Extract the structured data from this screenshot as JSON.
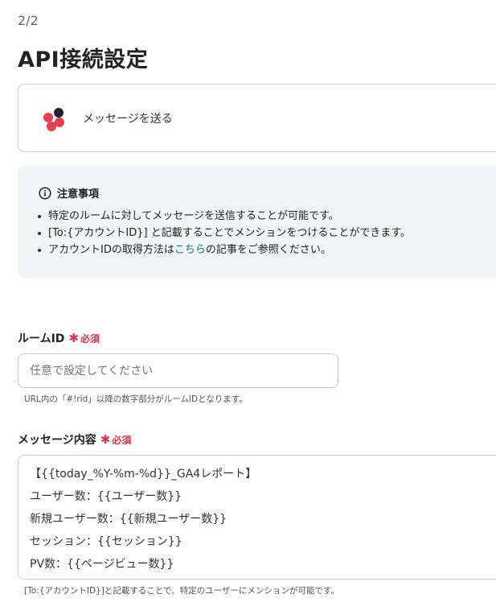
{
  "header": {
    "step": "2/2",
    "title": "API接続設定"
  },
  "action": {
    "label": "メッセージを送る",
    "app_icon": "chatwork-logo",
    "colors": {
      "dark": "#1f2333",
      "red": "#e83e50"
    }
  },
  "notice": {
    "icon": "info-icon",
    "title": "注意事項",
    "item1": "特定のルームに対してメッセージを送信することが可能です。",
    "item2": "[To:{アカウントID}] と記載することでメンションをつけることができます。",
    "item3_pre": "アカウントIDの取得方法は",
    "item3_link": "こちら",
    "item3_post": "の記事をご参照ください。",
    "bg_color": "#eef7f6",
    "link_color": "#1b6d8e"
  },
  "room_id": {
    "label": "ルームID",
    "required": "必須",
    "placeholder": "任意で設定してください",
    "help": "URL内の「#!rid」以降の数字部分がルームIDとなります。"
  },
  "message": {
    "label": "メッセージ内容",
    "required": "必須",
    "lines": [
      "【{{today_%Y-%m-%d}}_GA4レポート】",
      "ユーザー数：{{ユーザー数}}",
      "新規ユーザー数：{{新規ユーザー数}}",
      "セッション：{{セッション}}",
      "PV数：{{ページビュー数}}"
    ],
    "help": "[To:{アカウントID}]と記載することで、特定のユーザーにメンションが可能です。"
  },
  "colors": {
    "required": "#e0334a",
    "border": "#cccccc"
  }
}
